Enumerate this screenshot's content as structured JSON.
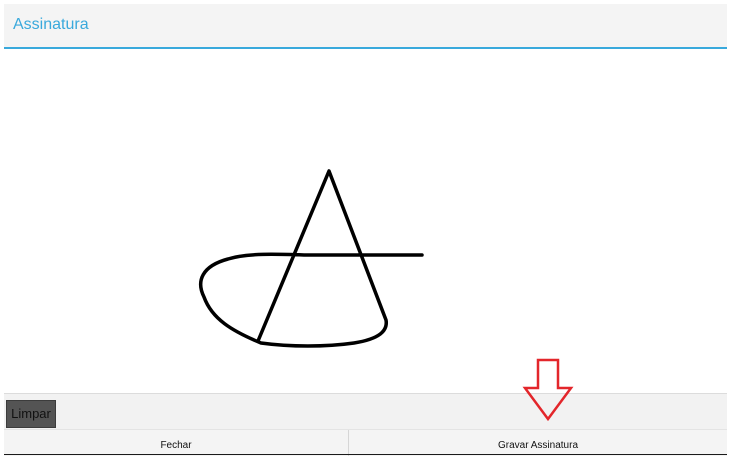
{
  "header": {
    "title": "Assinatura",
    "accent_color": "#39a9dc"
  },
  "signature_pad": {
    "stroke_color": "#000000"
  },
  "toolbar": {
    "clear_label": "Limpar",
    "hint_icon": "arrow-down-icon",
    "hint_color": "#e3262b"
  },
  "actions": {
    "close_label": "Fechar",
    "save_label": "Gravar Assinatura"
  }
}
